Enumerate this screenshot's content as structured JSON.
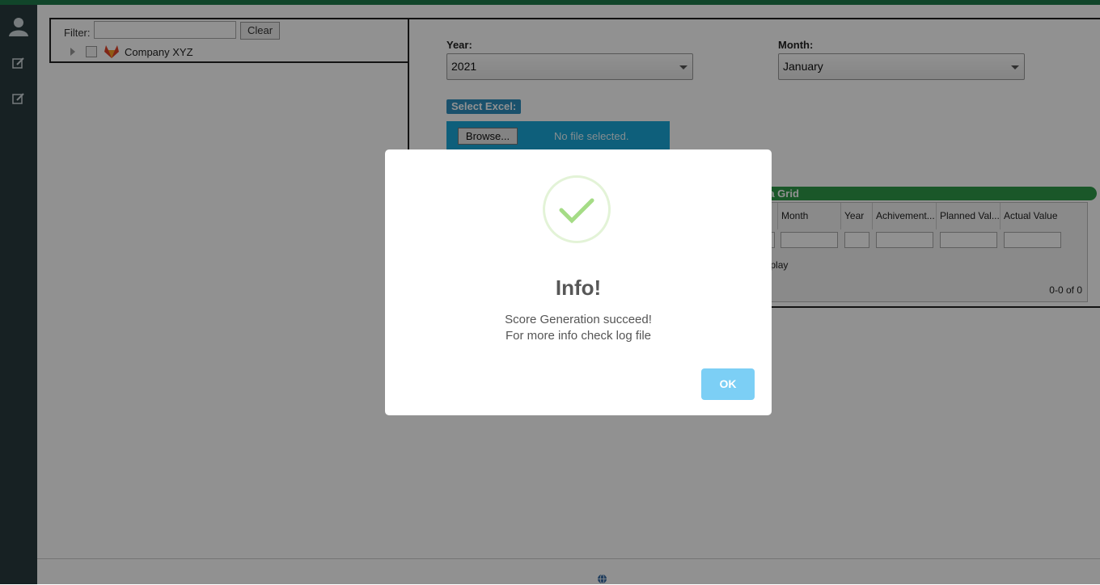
{
  "tree": {
    "filter_label": "Filter:",
    "filter_value": "",
    "clear_label": "Clear",
    "company_label": "Company XYZ"
  },
  "form": {
    "year_label": "Year:",
    "year_value": "2021",
    "month_label": "Month:",
    "month_value": "January",
    "excel_label": "Select Excel:",
    "browse_label": "Browse...",
    "no_file_text": "No file selected."
  },
  "grid": {
    "title": "ta Grid",
    "columns": [
      "Month",
      "Year",
      "Achivement...",
      "Planned Val...",
      "Actual Value"
    ],
    "empty_text": "o display",
    "pager_text": "0-0 of 0"
  },
  "modal": {
    "title": "Info!",
    "line1": "Score Generation succeed!",
    "line2": "For more info check log file",
    "ok_label": "OK"
  },
  "colors": {
    "accent_green": "#2f9a48",
    "sidebar": "#2a3a3e",
    "ok_button": "#7ccff5",
    "check_green": "#a5dc86"
  }
}
